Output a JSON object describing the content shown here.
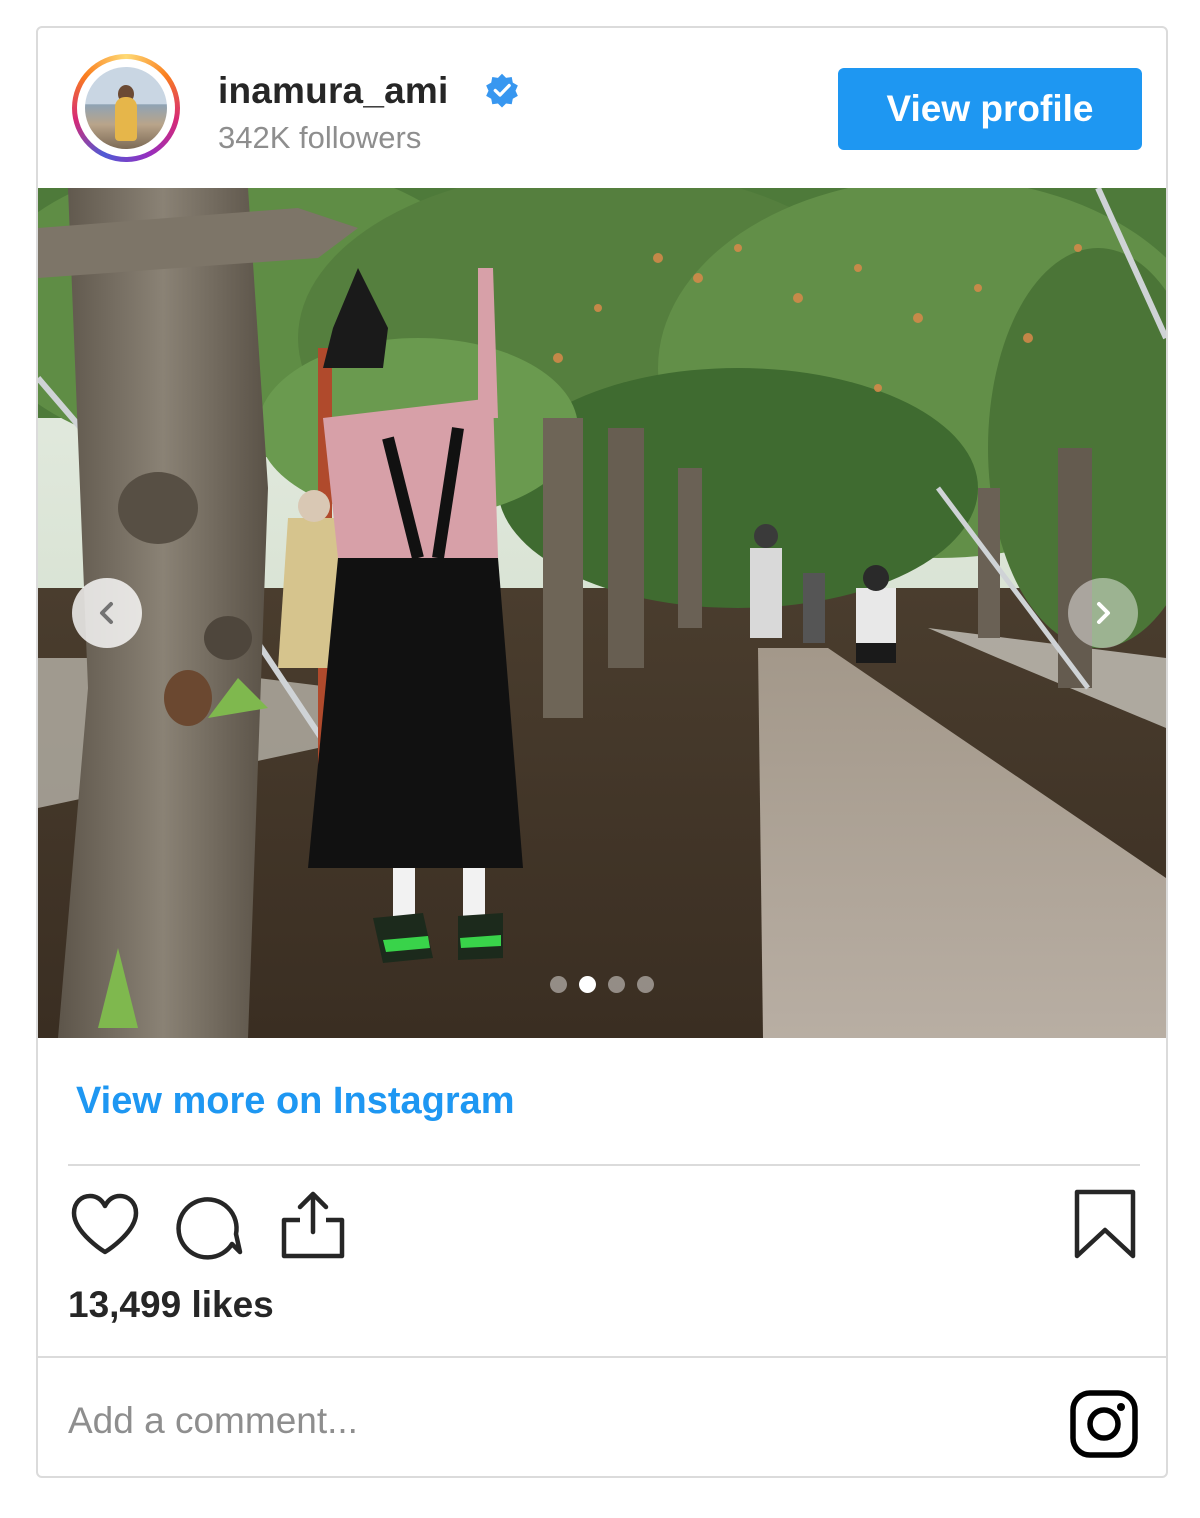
{
  "profile": {
    "username": "inamura_ami",
    "followers": "342K followers",
    "verified": true,
    "view_profile_label": "View profile"
  },
  "post": {
    "carousel": {
      "current_slide": 2,
      "total_slides": 4
    },
    "view_more_label": "View more on Instagram",
    "likes": "13,499 likes",
    "comment_placeholder": "Add a comment..."
  },
  "icons": {
    "verified": "verified-badge-icon",
    "prev": "chevron-left-icon",
    "next": "chevron-right-icon",
    "like": "heart-icon",
    "comment": "comment-bubble-icon",
    "share": "share-icon",
    "save": "bookmark-icon",
    "brand": "instagram-logo-icon"
  },
  "colors": {
    "accent": "#1e97f2",
    "text": "#262626",
    "muted": "#8e8e8e",
    "border": "#dbdbdb"
  }
}
